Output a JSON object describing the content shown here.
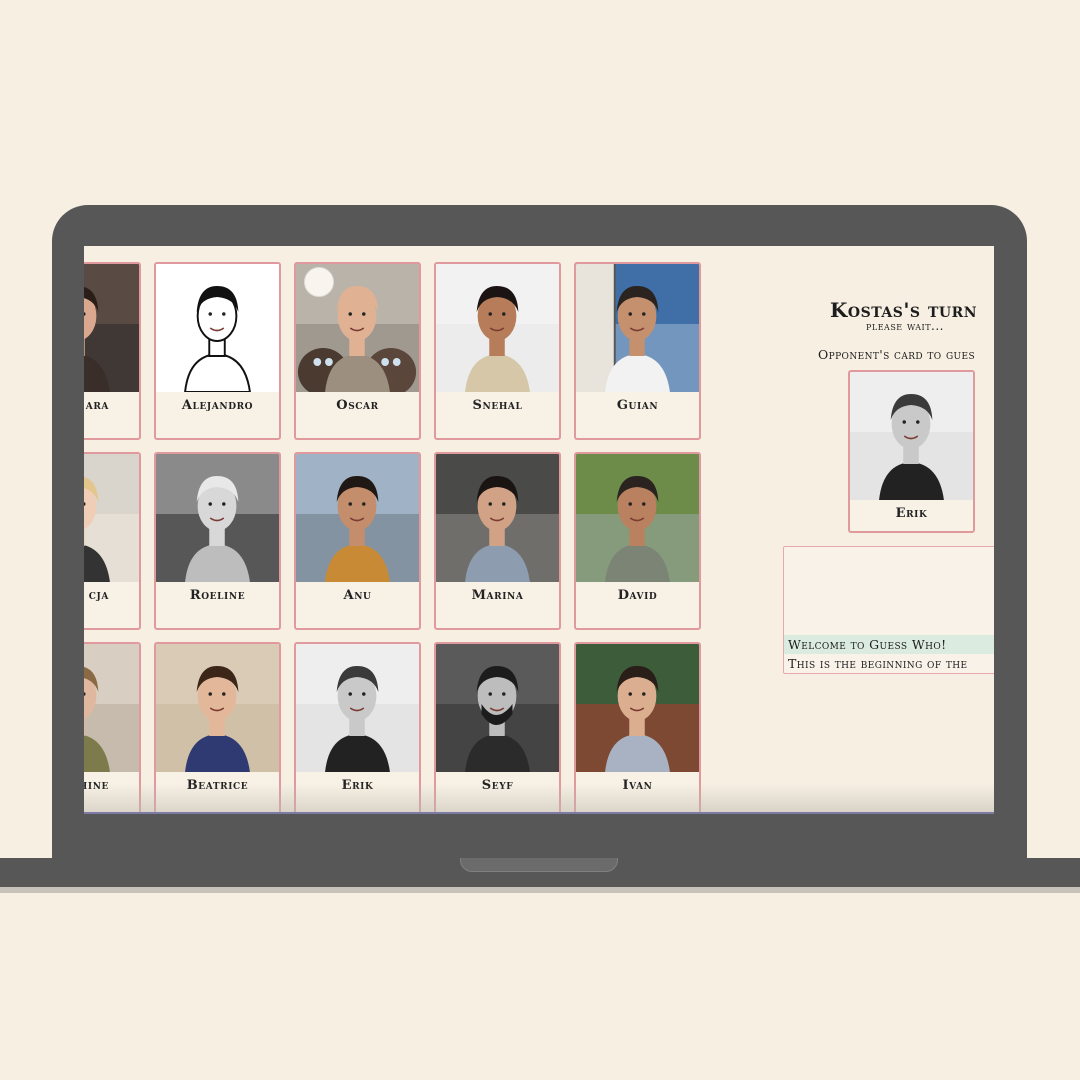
{
  "game": {
    "turn_title": "Kostas's turn",
    "turn_subtitle": "please wait...",
    "opponent_label": "Opponent's card to gues",
    "opponent_card": {
      "name": "Erik",
      "photo": "portrait-bw"
    }
  },
  "chat": {
    "messages": [
      {
        "text": "Welcome to Guess Who!",
        "highlight": true
      },
      {
        "text": "This is the beginning of the",
        "highlight": false
      }
    ]
  },
  "cards": [
    {
      "name": "ara",
      "photo": "selfie-woman"
    },
    {
      "name": "Alejandro",
      "photo": "sketch-man"
    },
    {
      "name": "Oscar",
      "photo": "man-with-cats"
    },
    {
      "name": "Snehal",
      "photo": "woman-striped"
    },
    {
      "name": "Guian",
      "photo": "man-sailboat"
    },
    {
      "name": "cja",
      "photo": "blonde-woman"
    },
    {
      "name": "Roeline",
      "photo": "woman-bw-outdoor"
    },
    {
      "name": "Anu",
      "photo": "woman-city"
    },
    {
      "name": "Marina",
      "photo": "woman-dark-hair"
    },
    {
      "name": "David",
      "photo": "man-waterfall"
    },
    {
      "name": "hine",
      "photo": "woman-long-hair"
    },
    {
      "name": "Beatrice",
      "photo": "woman-smiling"
    },
    {
      "name": "Erik",
      "photo": "portrait-bw"
    },
    {
      "name": "Seyf",
      "photo": "bearded-man-bw"
    },
    {
      "name": "Ivan",
      "photo": "young-man"
    }
  ]
}
